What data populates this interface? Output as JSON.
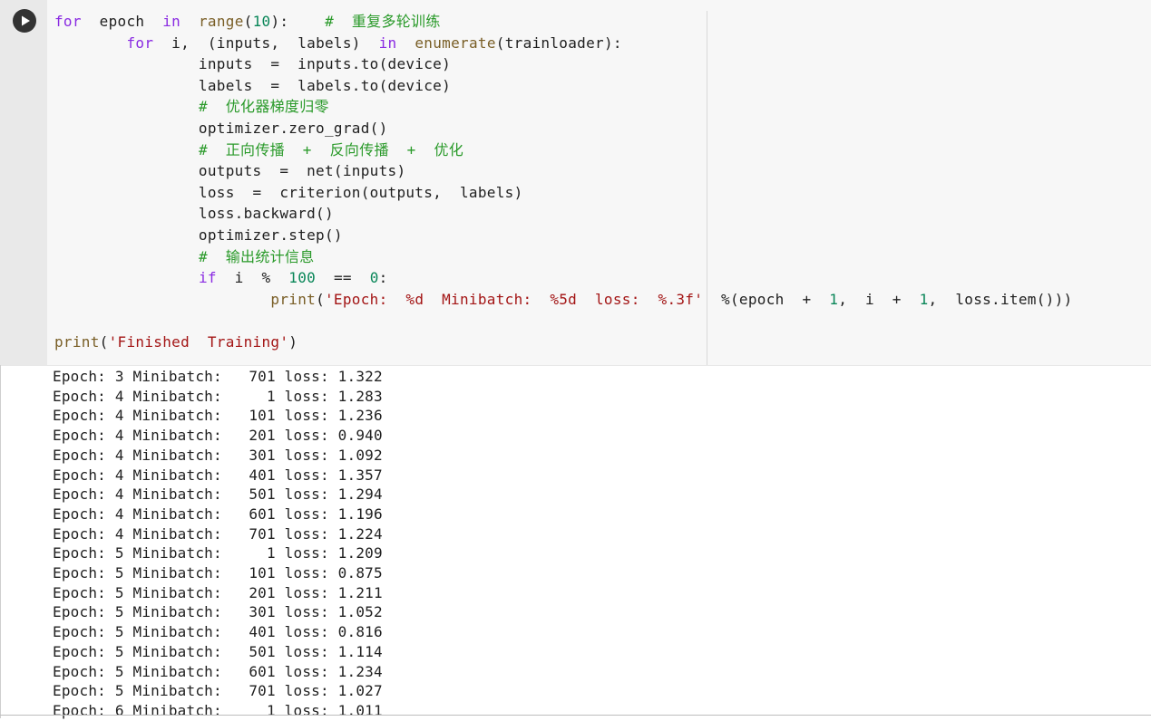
{
  "cell": {
    "run_button_icon": "play-icon",
    "code_lines": [
      [
        {
          "t": "for",
          "c": "kw"
        },
        {
          "t": "  epoch  ",
          "c": ""
        },
        {
          "t": "in",
          "c": "kw"
        },
        {
          "t": "  ",
          "c": ""
        },
        {
          "t": "range",
          "c": "bi"
        },
        {
          "t": "(",
          "c": ""
        },
        {
          "t": "10",
          "c": "num"
        },
        {
          "t": "):    ",
          "c": ""
        },
        {
          "t": "#  重复多轮训练",
          "c": "cm"
        }
      ],
      [
        {
          "t": "        ",
          "c": ""
        },
        {
          "t": "for",
          "c": "kw"
        },
        {
          "t": "  i,  (inputs,  labels)  ",
          "c": ""
        },
        {
          "t": "in",
          "c": "kw"
        },
        {
          "t": "  ",
          "c": ""
        },
        {
          "t": "enumerate",
          "c": "bi"
        },
        {
          "t": "(trainloader):",
          "c": ""
        }
      ],
      [
        {
          "t": "                inputs  =  inputs.to(device)",
          "c": ""
        }
      ],
      [
        {
          "t": "                labels  =  labels.to(device)",
          "c": ""
        }
      ],
      [
        {
          "t": "                ",
          "c": ""
        },
        {
          "t": "#  优化器梯度归零",
          "c": "cm"
        }
      ],
      [
        {
          "t": "                optimizer.zero_grad()",
          "c": ""
        }
      ],
      [
        {
          "t": "                ",
          "c": ""
        },
        {
          "t": "#  正向传播  +  反向传播  +  优化",
          "c": "cm"
        }
      ],
      [
        {
          "t": "                outputs  =  net(inputs)",
          "c": ""
        }
      ],
      [
        {
          "t": "                loss  =  criterion(outputs,  labels)",
          "c": ""
        }
      ],
      [
        {
          "t": "                loss.backward()",
          "c": ""
        }
      ],
      [
        {
          "t": "                optimizer.step()",
          "c": ""
        }
      ],
      [
        {
          "t": "                ",
          "c": ""
        },
        {
          "t": "#  输出统计信息",
          "c": "cm"
        }
      ],
      [
        {
          "t": "                ",
          "c": ""
        },
        {
          "t": "if",
          "c": "kw"
        },
        {
          "t": "  i  %  ",
          "c": ""
        },
        {
          "t": "100",
          "c": "num"
        },
        {
          "t": "  ==  ",
          "c": ""
        },
        {
          "t": "0",
          "c": "num"
        },
        {
          "t": ":",
          "c": ""
        }
      ],
      [
        {
          "t": "                        ",
          "c": ""
        },
        {
          "t": "print",
          "c": "bi"
        },
        {
          "t": "(",
          "c": ""
        },
        {
          "t": "'Epoch:  %d  Minibatch:  %5d  loss:  %.3f'",
          "c": "str"
        },
        {
          "t": "  %(epoch  +  ",
          "c": ""
        },
        {
          "t": "1",
          "c": "num"
        },
        {
          "t": ",  i  +  ",
          "c": ""
        },
        {
          "t": "1",
          "c": "num"
        },
        {
          "t": ",  loss.item()))",
          "c": ""
        }
      ],
      [
        {
          "t": "",
          "c": ""
        }
      ],
      [
        {
          "t": "print",
          "c": "bi"
        },
        {
          "t": "(",
          "c": ""
        },
        {
          "t": "'Finished  Training'",
          "c": "str"
        },
        {
          "t": ")",
          "c": ""
        }
      ]
    ]
  },
  "output": {
    "lines": [
      "Epoch: 3 Minibatch:   701 loss: 1.322",
      "Epoch: 4 Minibatch:     1 loss: 1.283",
      "Epoch: 4 Minibatch:   101 loss: 1.236",
      "Epoch: 4 Minibatch:   201 loss: 0.940",
      "Epoch: 4 Minibatch:   301 loss: 1.092",
      "Epoch: 4 Minibatch:   401 loss: 1.357",
      "Epoch: 4 Minibatch:   501 loss: 1.294",
      "Epoch: 4 Minibatch:   601 loss: 1.196",
      "Epoch: 4 Minibatch:   701 loss: 1.224",
      "Epoch: 5 Minibatch:     1 loss: 1.209",
      "Epoch: 5 Minibatch:   101 loss: 0.875",
      "Epoch: 5 Minibatch:   201 loss: 1.211",
      "Epoch: 5 Minibatch:   301 loss: 1.052",
      "Epoch: 5 Minibatch:   401 loss: 0.816",
      "Epoch: 5 Minibatch:   501 loss: 1.114",
      "Epoch: 5 Minibatch:   601 loss: 1.234",
      "Epoch: 5 Minibatch:   701 loss: 1.027",
      "Epoch: 6 Minibatch:     1 loss: 1.011"
    ]
  }
}
